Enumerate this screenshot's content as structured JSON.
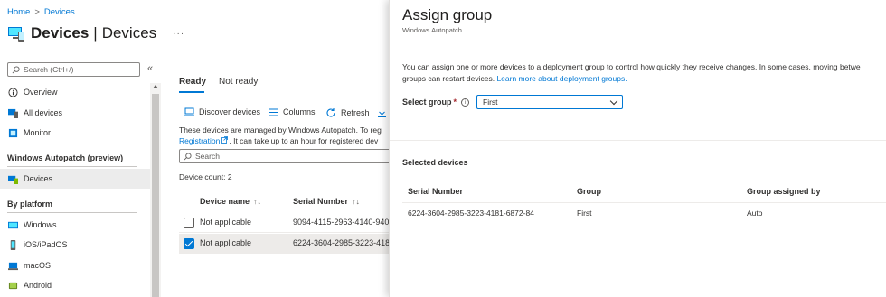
{
  "breadcrumb": {
    "home": "Home",
    "separator": ">",
    "current": "Devices"
  },
  "page": {
    "title": "Devices",
    "separator": "|",
    "subtitle": "Devices",
    "more": "···"
  },
  "sidebar": {
    "search_placeholder": "Search (Ctrl+/)",
    "collapse": "«",
    "items_top": [
      {
        "label": "Overview",
        "icon": "info-icon"
      },
      {
        "label": "All devices",
        "icon": "all-devices-icon"
      },
      {
        "label": "Monitor",
        "icon": "monitor-icon"
      }
    ],
    "section1": "Windows Autopatch (preview)",
    "devices": {
      "label": "Devices",
      "icon": "devices-icon"
    },
    "section2": "By platform",
    "platforms": [
      {
        "label": "Windows",
        "icon": "windows-icon"
      },
      {
        "label": "iOS/iPadOS",
        "icon": "phone-icon"
      },
      {
        "label": "macOS",
        "icon": "laptop-icon"
      },
      {
        "label": "Android",
        "icon": "android-icon"
      }
    ]
  },
  "tabs": [
    {
      "label": "Ready"
    },
    {
      "label": "Not ready"
    }
  ],
  "toolbar": {
    "discover": "Discover devices",
    "columns": "Columns",
    "refresh": "Refresh"
  },
  "info": {
    "line1": "These devices are managed by Windows Autopatch. To reg",
    "link": "Registration",
    "line2_rest": ". It can take up to an hour for registered dev"
  },
  "list": {
    "search_placeholder": "Search",
    "device_count": "Device count: 2",
    "columns": [
      "Device name",
      "Serial Number"
    ],
    "sort_glyph": "↑↓",
    "rows": [
      {
        "name": "Not applicable",
        "serial": "9094-4115-2963-4140-940",
        "checked": false
      },
      {
        "name": "Not applicable",
        "serial": "6224-3604-2985-3223-418",
        "checked": true
      }
    ]
  },
  "panel": {
    "title": "Assign group",
    "subtitle": "Windows Autopatch",
    "description_line1": "You can assign one or more devices to a deployment group to control how quickly they receive changes. In some cases, moving betwe",
    "description_line2": "groups can restart devices.",
    "description_link": "Learn more about deployment groups.",
    "select_label": "Select group",
    "required_mark": "*",
    "info_glyph": "i",
    "select_value": "First",
    "selected_heading": "Selected devices",
    "columns": [
      "Serial Number",
      "Group",
      "Group assigned by"
    ],
    "rows": [
      {
        "serial": "6224-3604-2985-3223-4181-6872-84",
        "group": "First",
        "assigned_by": "Auto"
      }
    ]
  },
  "colors": {
    "accent": "#0078d4",
    "active_nav": "#ececec",
    "required": "#a4262c"
  }
}
